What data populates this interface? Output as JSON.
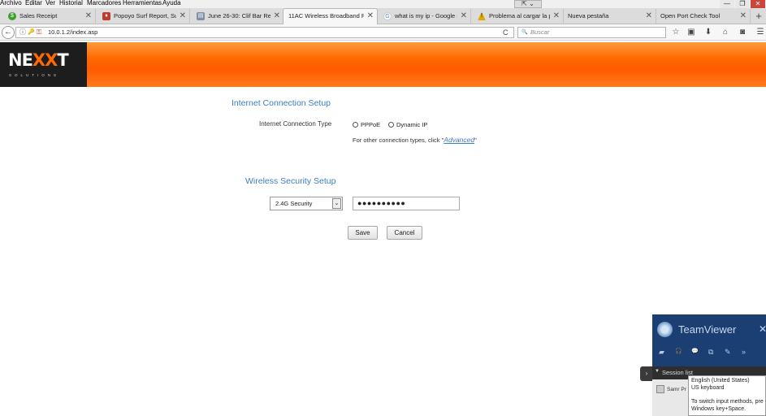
{
  "menu": [
    "Archivo",
    "Editar",
    "Ver",
    "Historial",
    "Marcadores",
    "Herramientas",
    "Ayuda"
  ],
  "window_controls": {
    "minimize": "—",
    "restore": "❐",
    "close": "✕",
    "dropdown": "⇱ ⌄"
  },
  "tabs": [
    {
      "label": "Sales Receipt",
      "icon": "green-circle-icon",
      "icon_color": "#3aa02a",
      "glyph": "$"
    },
    {
      "label": "Popoyo Surf Report, Surf",
      "icon": "surf-icon",
      "icon_color": "#c0392b",
      "glyph": "♦"
    },
    {
      "label": "June 26-30: Clif Bar Rese",
      "icon": "document-icon",
      "icon_color": "#7f8fa6",
      "glyph": "▤"
    },
    {
      "label": "11AC Wireless Broadband Ro",
      "icon": "",
      "icon_color": "",
      "glyph": ""
    },
    {
      "label": "what is my ip - Google S",
      "icon": "google-icon",
      "icon_color": "#4285f4",
      "glyph": "G"
    },
    {
      "label": "Problema al cargar la pá",
      "icon": "warning-icon",
      "icon_color": "#e0a800",
      "glyph": "!"
    },
    {
      "label": "Nueva pestaña",
      "icon": "",
      "icon_color": "",
      "glyph": ""
    },
    {
      "label": "Open Port Check Tool",
      "icon": "",
      "icon_color": "",
      "glyph": ""
    }
  ],
  "tab_close": "✕",
  "new_tab": "+",
  "nav": {
    "back": "←",
    "url": "10.0.1.2/index.asp",
    "reload": "C",
    "search_placeholder": "Buscar",
    "search_glyph": "🔍",
    "info_glyph": "ⓘ",
    "key_glyph": "🔑",
    "lock_glyph": "⚿",
    "toolbar": [
      "☆",
      "▣",
      "⬇",
      "⌂",
      "◙",
      "☰"
    ]
  },
  "brand": {
    "logo_pre": "NE",
    "logo_x1": "X",
    "logo_x2": "X",
    "logo_post": "T",
    "tagline": "SOLUTIONS",
    "accent": "#ff6a00"
  },
  "internet": {
    "title": "Internet Connection Setup",
    "type_label": "Internet Connection Type",
    "options": [
      "PPPoE",
      "Dynamic IP"
    ],
    "other_text": "For other connection types, click  \"",
    "advanced_link": "Advanced",
    "other_text_end": "\""
  },
  "wireless": {
    "title": "Wireless Security Setup",
    "security_selected": "2.4G Security",
    "dropdown_arrow": "⌄",
    "password_value": "●●●●●●●●●●"
  },
  "buttons": {
    "save": "Save",
    "cancel": "Cancel"
  },
  "teamviewer": {
    "title": "TeamViewer",
    "close": "✕",
    "tools": [
      "▰",
      "🎧",
      "💬",
      "⧉",
      "✎",
      "»"
    ],
    "session_caret": "▼",
    "session_label": "Session list",
    "session_user": "Samr Pr",
    "handle": "›"
  },
  "ime_tooltip": {
    "line1": "English (United States)",
    "line2": "US keyboard",
    "line3": "To switch input methods, pre",
    "line4": "Windows key+Space."
  }
}
